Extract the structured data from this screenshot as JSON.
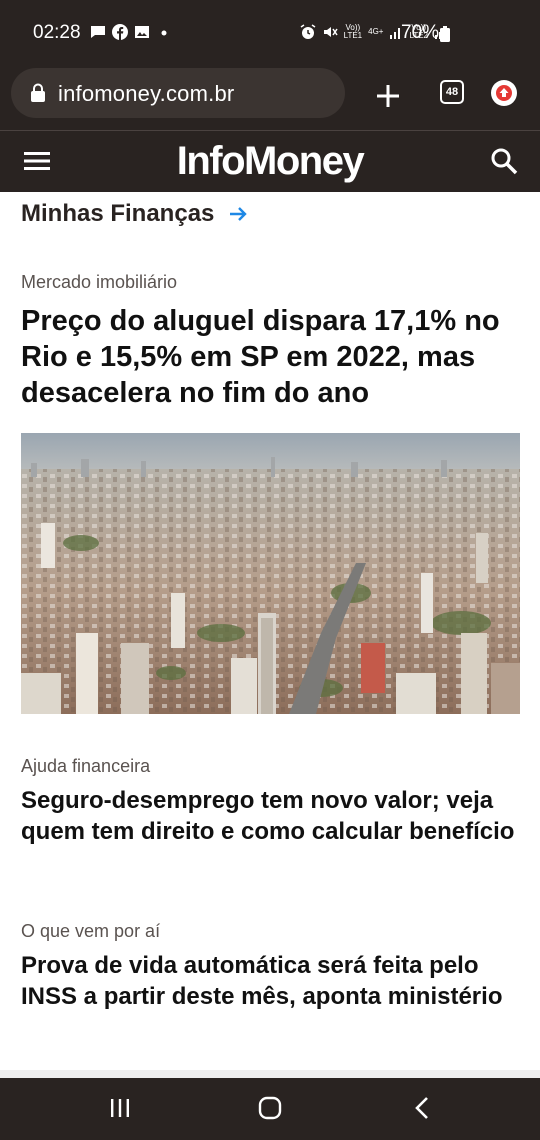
{
  "status_bar": {
    "time": "02:28",
    "battery": "70%",
    "network_1": {
      "top": "Vo))",
      "bottom": "LTE1"
    },
    "network_type": "4G+",
    "network_2": {
      "top": "Vo))",
      "bottom": "LTE2"
    },
    "left_icons": [
      "message-icon",
      "facebook-icon",
      "image-icon",
      "dot-icon"
    ],
    "right_icons": [
      "alarm-icon",
      "mute-icon",
      "signal-icon",
      "battery-icon"
    ]
  },
  "browser": {
    "url": "infomoney.com.br",
    "tab_count": "48",
    "colors": {
      "chrome_bg": "#292321",
      "url_pill": "#3b3431",
      "update_accent": "#e53935"
    }
  },
  "site_header": {
    "logo": "InfoMoney",
    "icons": [
      "menu-icon",
      "search-icon"
    ]
  },
  "section": {
    "title": "Minhas Finanças",
    "arrow_color": "#1e88e5"
  },
  "articles": [
    {
      "kicker": "Mercado imobiliário",
      "headline": "Preço do aluguel dispara 17,1% no Rio e 15,5% em SP em 2022, mas desacelera no fim do ano"
    },
    {
      "kicker": "Ajuda financeira",
      "headline": "Seguro-desemprego tem novo valor; veja quem tem direito e como calcular benefício"
    },
    {
      "kicker": "O que vem por aí",
      "headline": "Prova de vida automática será feita pelo INSS a partir deste mês, aponta ministério"
    }
  ],
  "nav_bar": {
    "icons": [
      "recents-icon",
      "home-icon",
      "back-icon"
    ]
  }
}
